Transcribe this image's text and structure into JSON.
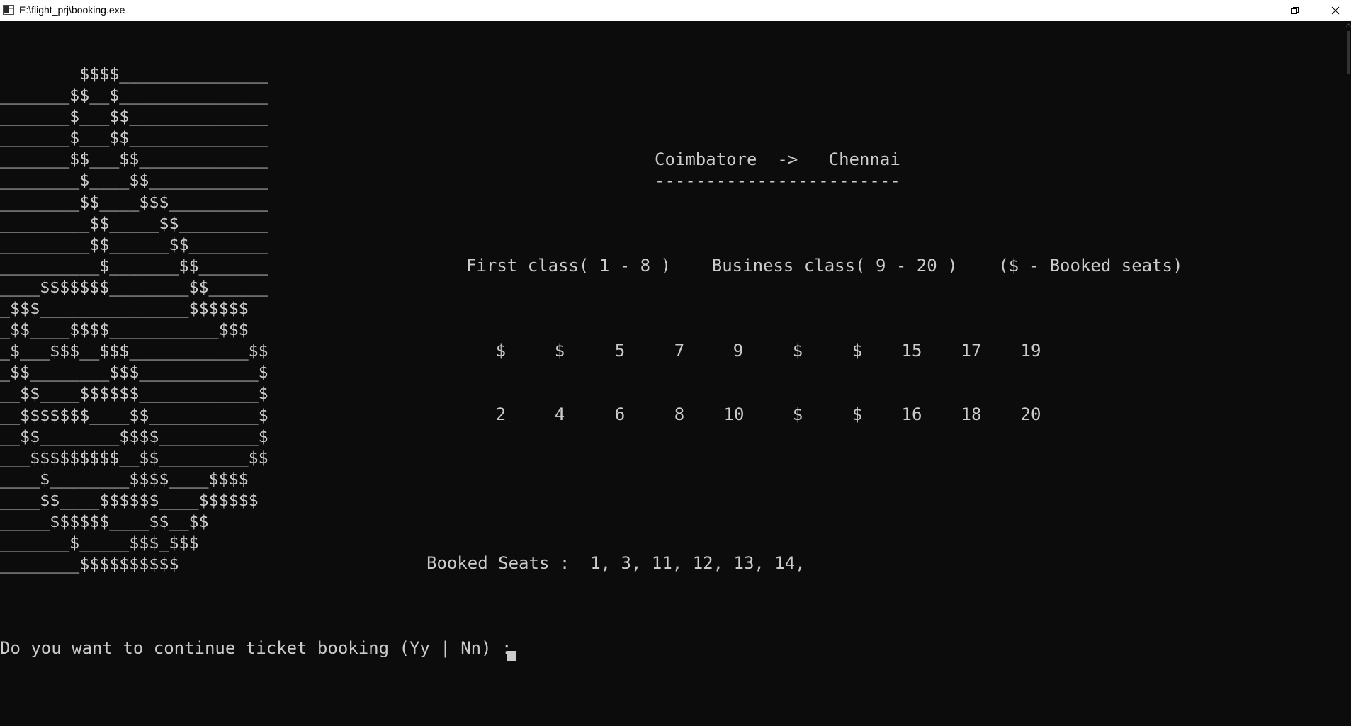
{
  "window": {
    "title": "E:\\flight_prj\\booking.exe"
  },
  "ascii_art": "        $$$$_______________\n_______$$__$_______________\n_______$___$$______________\n_______$___$$______________\n_______$$___$$_____________\n________$____$$____________\n________$$____$$$__________\n_________$$_____$$_________\n_________$$______$$________\n__________$_______$$_______\n____$$$$$$$________$$______\n_$$$_______________$$$$$$\n_$$____$$$$___________$$$\n_$___$$$__$$$____________$$\n_$$________$$$____________$\n__$$____$$$$$$____________$\n__$$$$$$$____$$___________$\n__$$________$$$$__________$\n___$$$$$$$$$__$$_________$$\n____$________$$$$____$$$$\n____$$____$$$$$$____$$$$$$\n_____$$$$$$____$$__$$\n_______$_____$$$_$$$\n________$$$$$$$$$$",
  "route": {
    "text": "Coimbatore  ->   Chennai",
    "underline": "------------------------"
  },
  "legend": "First class( 1 - 8 )    Business class( 9 - 20 )    ($ - Booked seats)",
  "seat_rows": [
    [
      "$",
      "$",
      "5",
      "7",
      "9",
      "$",
      "$",
      "15",
      "17",
      "19"
    ],
    [
      "2",
      "4",
      "6",
      "8",
      "10",
      "$",
      "$",
      "16",
      "18",
      "20"
    ]
  ],
  "booked_seats": {
    "label": "Booked Seats :",
    "values": "1, 3, 11, 12, 13, 14,"
  },
  "prompt": "Do you want to continue ticket booking (Yy | Nn) :",
  "colors": {
    "console_bg": "#0c0c0c",
    "console_text": "#cccccc",
    "titlebar_bg": "#ffffff"
  }
}
